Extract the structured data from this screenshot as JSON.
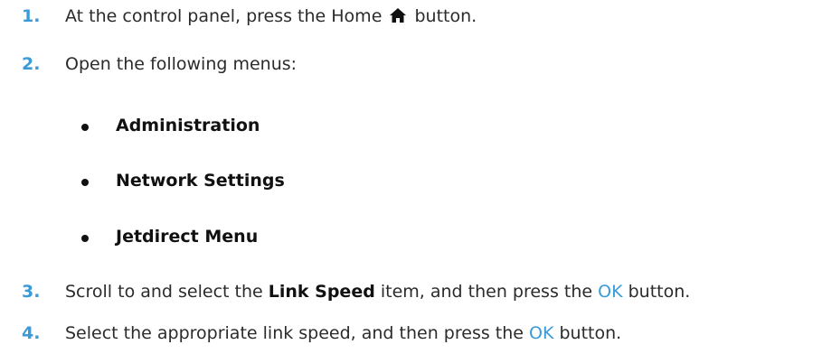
{
  "colors": {
    "accent": "#3b9ad8",
    "text": "#2b2b2b"
  },
  "steps": [
    {
      "number": "1.",
      "before_icon": "At the control panel, press the Home",
      "icon": "home-icon",
      "after_icon": "button."
    },
    {
      "number": "2.",
      "text": "Open the following menus:"
    },
    {
      "number": "3.",
      "before": "Scroll to and select the",
      "bold": "Link Speed",
      "middle": "item, and then press the",
      "button": "OK",
      "after": "button."
    },
    {
      "number": "4.",
      "before": "Select the appropriate link speed, and then press the",
      "button": "OK",
      "after": "button."
    }
  ],
  "menus": [
    "Administration",
    "Network Settings",
    "Jetdirect Menu"
  ]
}
